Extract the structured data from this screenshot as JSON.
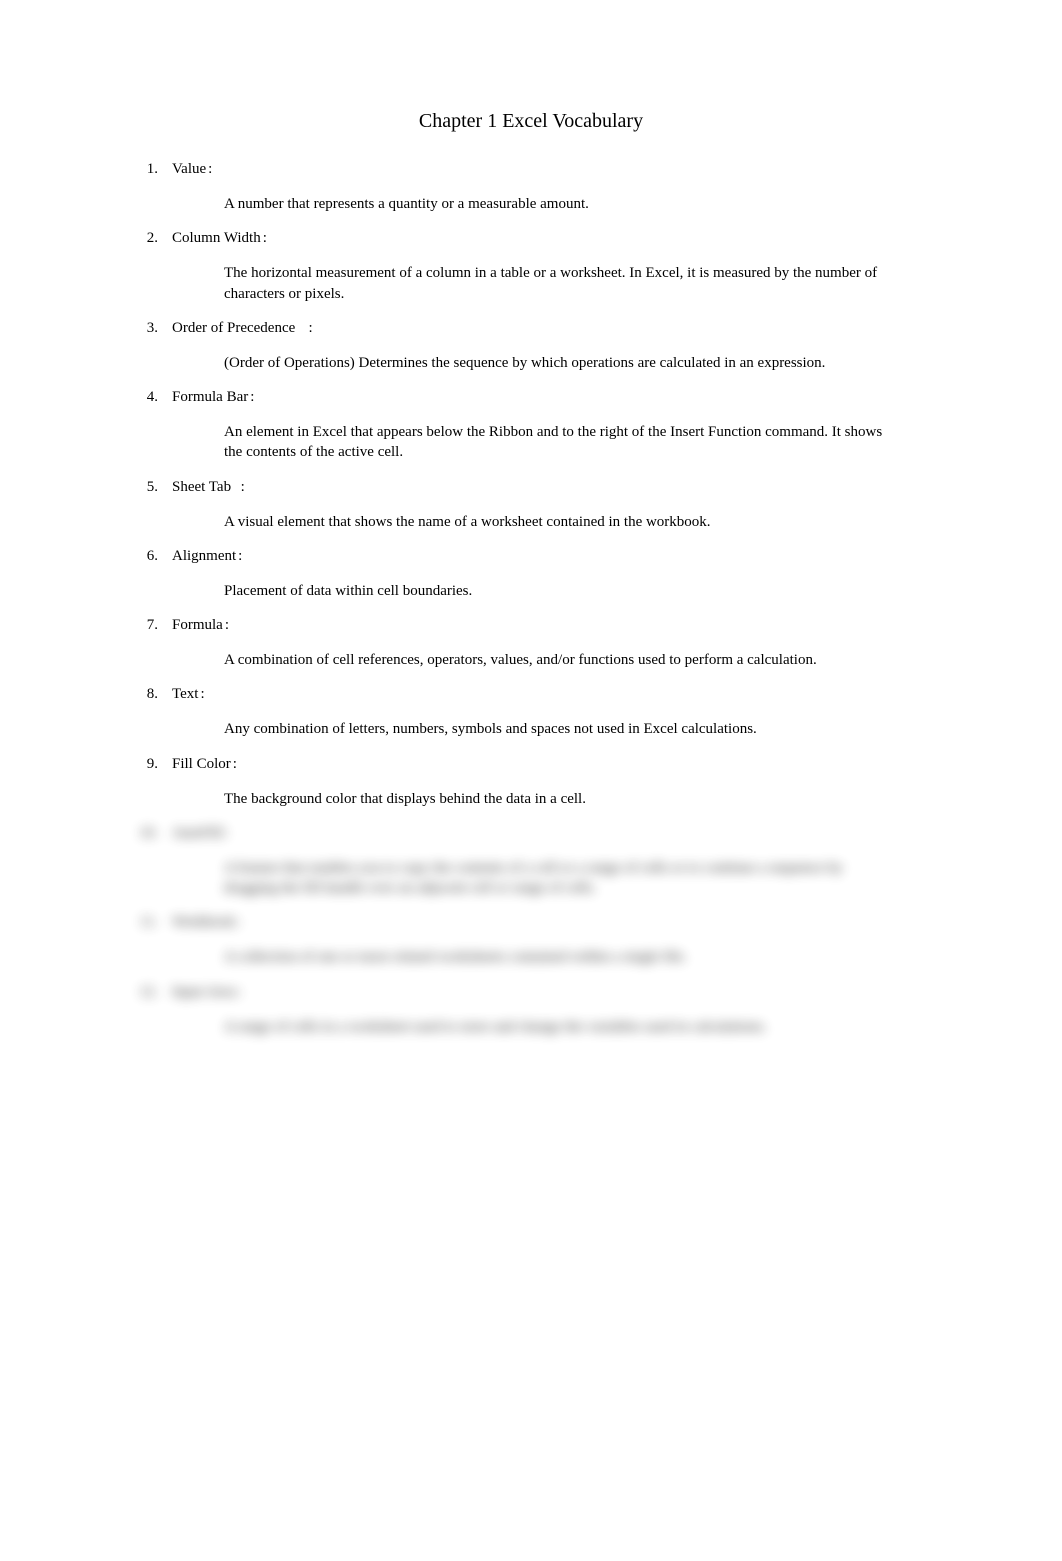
{
  "title": "Chapter 1 Excel Vocabulary",
  "items": [
    {
      "num": "1.",
      "term": "Value",
      "definition": "A number that represents a quantity or a measurable amount."
    },
    {
      "num": "2.",
      "term": "Column Width",
      "definition": "The horizontal measurement of a column in a table or a worksheet. In Excel, it is measured by the number of characters or pixels."
    },
    {
      "num": "3.",
      "term": "Order of Precedence",
      "definition": "(Order of Operations) Determines the sequence by which operations are calculated in an expression."
    },
    {
      "num": "4.",
      "term": "Formula Bar",
      "definition": "An element in Excel that appears below the Ribbon and to the right of the Insert Function command. It shows the contents of the active cell."
    },
    {
      "num": "5.",
      "term": "Sheet Tab",
      "definition": "A visual element that shows the name of a worksheet contained in the workbook."
    },
    {
      "num": "6.",
      "term": "Alignment",
      "definition": "Placement of data within cell boundaries."
    },
    {
      "num": "7.",
      "term": "Formula",
      "definition": "A combination of cell references, operators, values, and/or functions used to perform a calculation."
    },
    {
      "num": "8.",
      "term": "Text",
      "definition": "Any combination of letters, numbers, symbols and spaces not used in Excel calculations."
    },
    {
      "num": "9.",
      "term": "Fill Color",
      "definition": "The background color that displays behind the data in a cell."
    },
    {
      "num": "10.",
      "term": "AutoFill",
      "definition": "A feature that enables you to copy the contents of a cell or a range of cells or to continue a sequence by dragging the fill handle over an adjacent cell or range of cells.",
      "blurred": true
    },
    {
      "num": "11.",
      "term": "Workbook",
      "definition": "A collection of one or more related worksheets contained within a single file.",
      "blurred": true
    },
    {
      "num": "12.",
      "term": "Input Area",
      "definition": "A range of cells in a worksheet used to store and change the variables used in calculations.",
      "blurred": true
    }
  ]
}
